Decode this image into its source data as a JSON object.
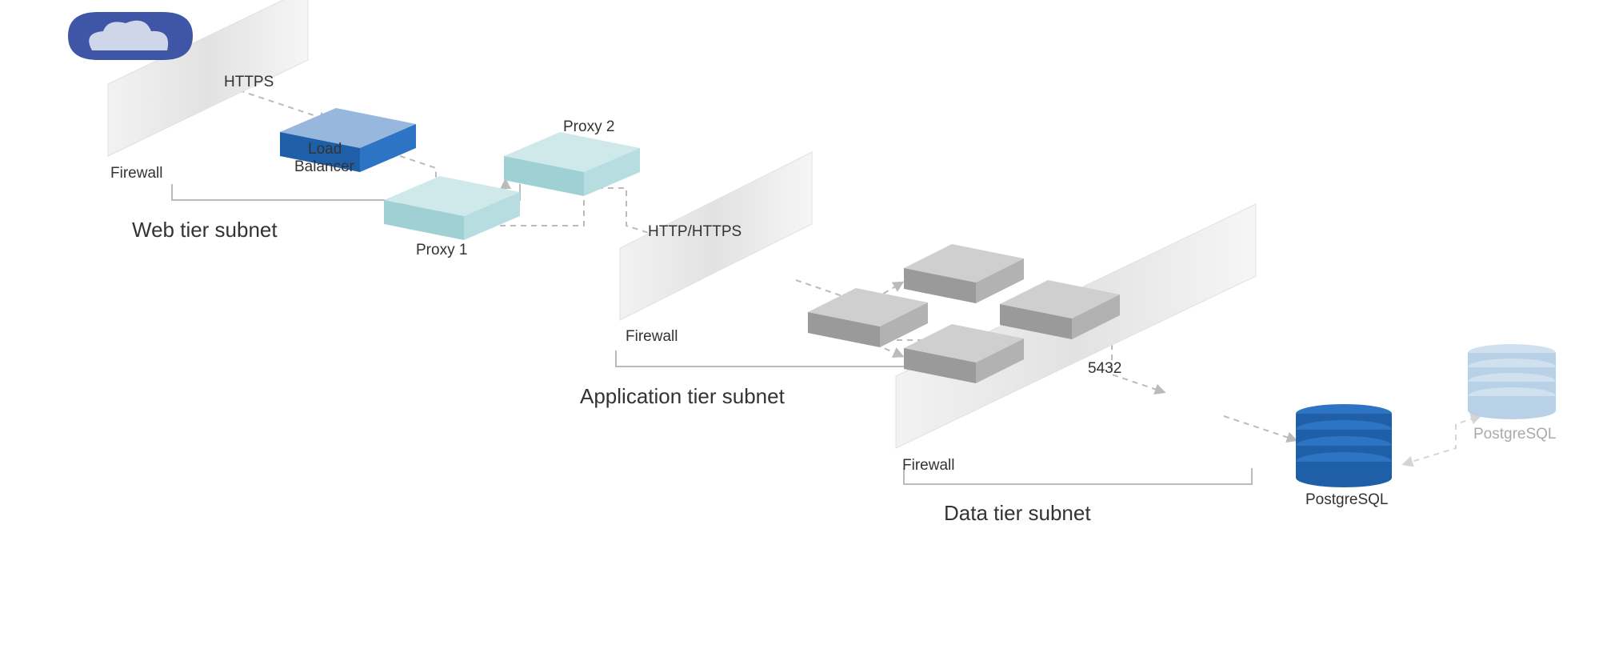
{
  "labels": {
    "cloud": "",
    "firewall1": "Firewall",
    "firewall2": "Firewall",
    "firewall3": "Firewall",
    "https": "HTTPS",
    "httphttps": "HTTP/HTTPS",
    "port_db": "5432",
    "lb1": "Load",
    "lb2": "Balancer",
    "proxy1": "Proxy 1",
    "proxy2": "Proxy 2",
    "tier_web": "Web tier subnet",
    "tier_app": "Application tier subnet",
    "tier_data": "Data tier subnet",
    "db1": "PostgreSQL",
    "db2": "PostgreSQL"
  }
}
